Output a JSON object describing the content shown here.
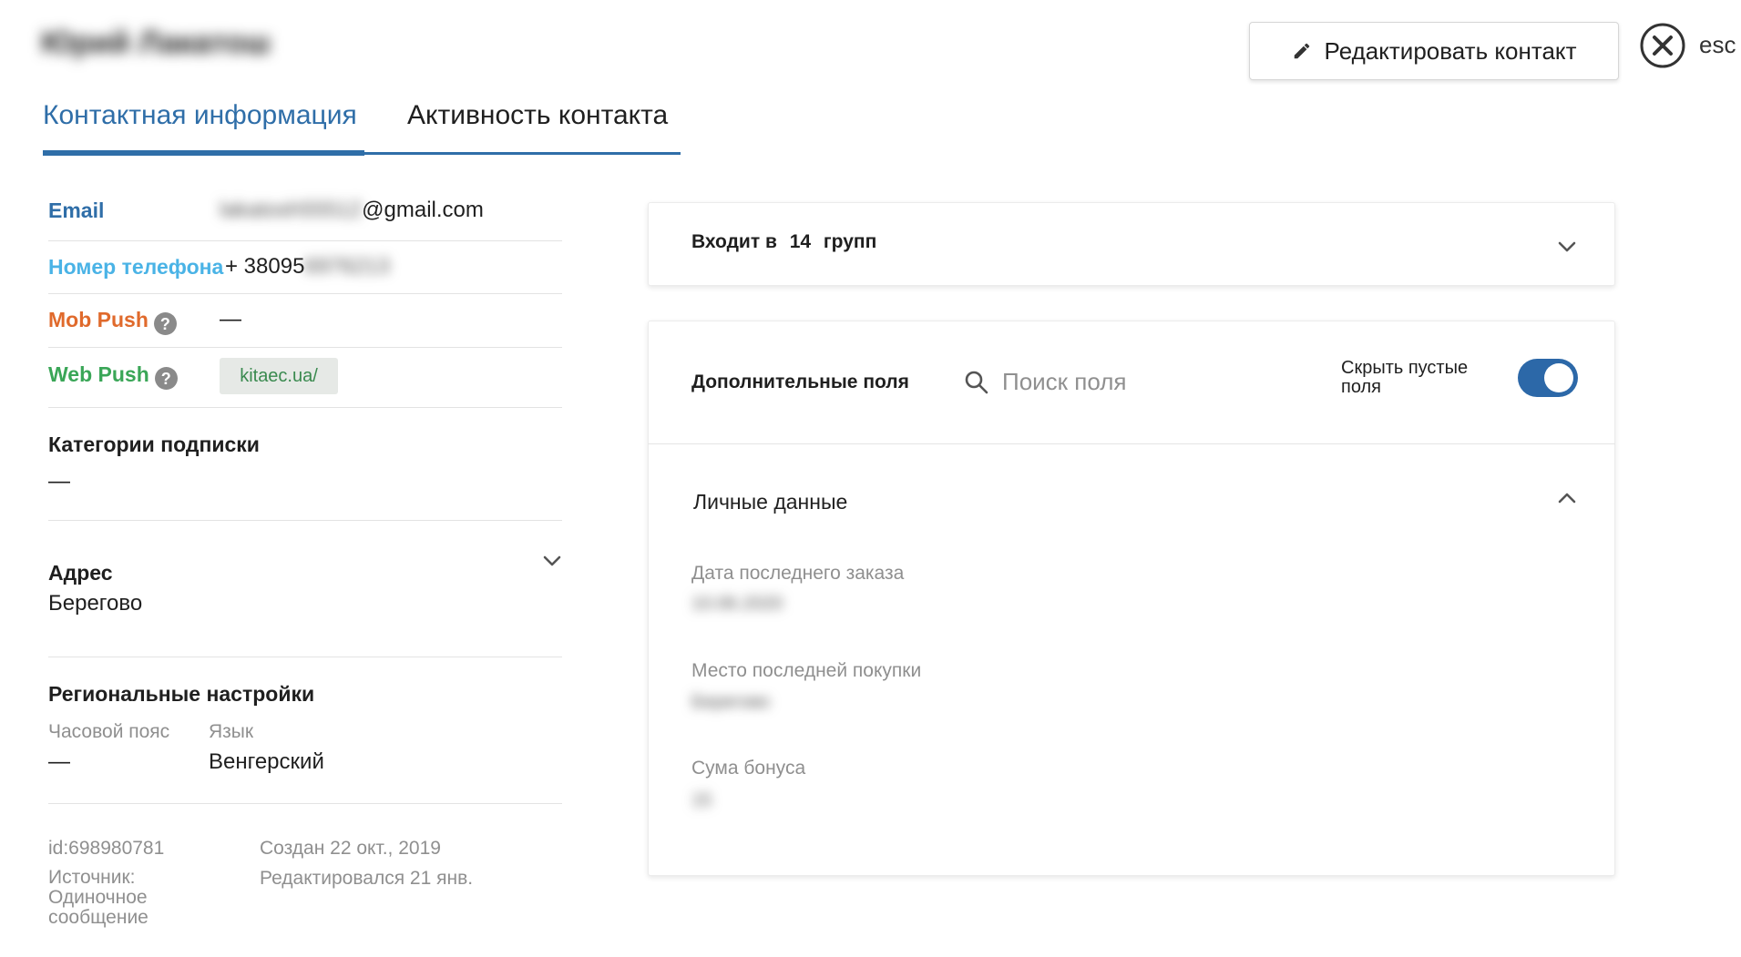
{
  "header": {
    "contact_name": "Юрий Лакатош",
    "edit_button_label": "Редактировать контакт",
    "esc_label": "esc"
  },
  "tabs": [
    {
      "label": "Контактная информация",
      "active": true
    },
    {
      "label": "Активность контакта",
      "active": false
    }
  ],
  "contact": {
    "email": {
      "label": "Email",
      "value_hidden": "lakatosh55512",
      "value_suffix": "@gmail.com"
    },
    "phone": {
      "label": "Номер телефона",
      "value_prefix": "+ 38095",
      "value_hidden": "6976213"
    },
    "mob_push": {
      "label": "Mob Push",
      "value": "—"
    },
    "web_push": {
      "label": "Web Push",
      "chip": "kitaec.ua/"
    },
    "subscription": {
      "title": "Категории подписки",
      "value": "—"
    },
    "address": {
      "title": "Адрес",
      "value": "Берегово"
    },
    "regional": {
      "title": "Региональные настройки",
      "timezone_label": "Часовой пояс",
      "timezone_value": "—",
      "language_label": "Язык",
      "language_value": "Венгерский"
    },
    "meta": {
      "id": "id:698980781",
      "source_label": "Источник:",
      "source_line1": "Одиночное",
      "source_line2": "сообщение",
      "created": "Создан 22 окт., 2019",
      "edited": "Редактировался 21 янв."
    }
  },
  "groups_card": {
    "prefix": "Входит в",
    "count": "14",
    "suffix": "групп"
  },
  "fields_card": {
    "title": "Дополнительные поля",
    "search_placeholder": "Поиск поля",
    "hide_empty_line1": "Скрыть пустые",
    "hide_empty_line2": "поля",
    "hide_empty_enabled": true,
    "section_title": "Личные данные",
    "fields": [
      {
        "label": "Дата последнего заказа",
        "value": "10.06.2020"
      },
      {
        "label": "Место последней покупки",
        "value": "Берегово"
      },
      {
        "label": "Сума бонуса",
        "value": "15"
      }
    ]
  },
  "colors": {
    "accent": "#2f6ea8",
    "email_label": "#2f6ea8",
    "phone_label": "#4ab3e6",
    "mob_push_label": "#e06a2c",
    "web_push_label": "#3aa657",
    "toggle_on": "#2c68a8"
  }
}
